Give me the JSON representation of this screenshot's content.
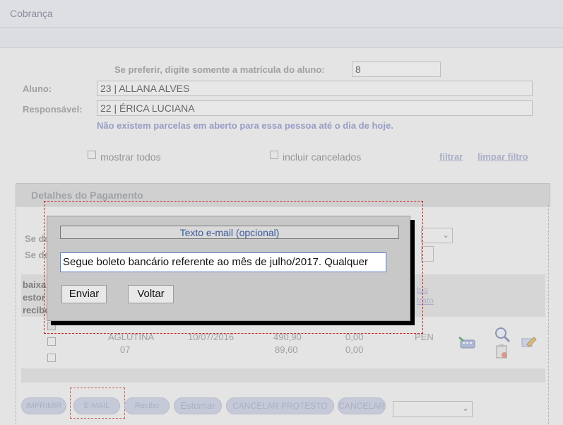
{
  "window": {
    "title": "Cobrança"
  },
  "search": {
    "label": "Se preferir, digite somente a matrícula do aluno:",
    "value": "8"
  },
  "aluno": {
    "label": "Aluno:",
    "value": "23 | ALLANA ALVES"
  },
  "responsavel": {
    "label": "Responsável:",
    "value": "22 | ÉRICA LUCIANA"
  },
  "message": "Não existem parcelas em aberto para essa pessoa até o dia de hoje.",
  "filters": {
    "mostrar_todos": "mostrar todos",
    "incluir_cancelados": "incluir cancelados",
    "filtrar": "filtrar",
    "limpar_filtro": "limpar filtro"
  },
  "section": {
    "title": "Detalhes do Pagamento",
    "se_de_1": "Se de",
    "se_de_2": "Se de"
  },
  "table": {
    "left_labels": [
      "baixar",
      "estor",
      "recibo"
    ],
    "status_header": [
      "tus",
      "trato"
    ],
    "row1": {
      "tipo": "AGLUTINA",
      "data": "10/07/2016",
      "valor": "490,90",
      "desc": "0,00",
      "status": "PEN"
    },
    "row2": {
      "tipo": "07",
      "valor": "89,60",
      "desc": "0,00"
    }
  },
  "buttons": {
    "imprimir": "IMPRIMIR",
    "email": "E-MAIL",
    "recibo": "Recibo",
    "estornar": "Estornar",
    "cancelar_protesto": "CANCELAR PROTESTO",
    "cancelar": "CANCELAR"
  },
  "modal": {
    "title": "Texto e-mail (opcional)",
    "text": "Segue boleto bancário referente ao mês de julho/2017. Qualquer",
    "send": "Enviar",
    "back": "Voltar"
  },
  "colors": {
    "accent_link": "#3a4fb8",
    "highlight_dashed": "#cc2020"
  }
}
